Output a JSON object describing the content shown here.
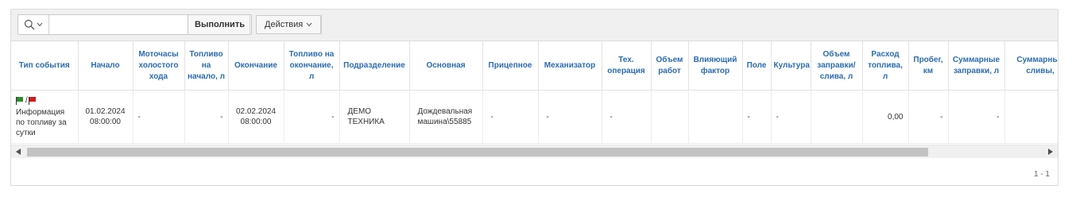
{
  "toolbar": {
    "search_placeholder": "",
    "go_label": "Выполнить",
    "actions_label": "Действия"
  },
  "table": {
    "columns": [
      "Тип события",
      "Начало",
      "Моточасы холостого хода",
      "Топливо на начало, л",
      "Окончание",
      "Топливо на окончание, л",
      "Подразделение",
      "Основная",
      "Прицепное",
      "Механизатор",
      "Тех. операция",
      "Объем работ",
      "Влияющий фактор",
      "Поле",
      "Культура",
      "Объем заправки/ слива, л",
      "Расход топлива, л",
      "Пробег, км",
      "Суммарные заправки, л",
      "Суммарные сливы,"
    ],
    "rows": [
      {
        "event_type": "Информация по топливу за сутки",
        "flag_separator": "/",
        "start": "01.02.2024 08:00:00",
        "idle_hours": "-",
        "fuel_start": "-",
        "end": "02.02.2024 08:00:00",
        "fuel_end": "-",
        "division": "ДЕМО ТЕХНИКА",
        "main": "Дождевальная машина\\55885",
        "trailer": "-",
        "operator": "-",
        "tech_operation": "-",
        "work_volume": "",
        "factor": "",
        "field": "-",
        "crop": "-",
        "refuel_volume": "",
        "fuel_consumption": "0,00",
        "mileage": "-",
        "total_refuels": "-",
        "total_drains": ""
      }
    ]
  },
  "pagination": {
    "range": "1 - 1"
  },
  "colors": {
    "header_text": "#2b6cb0",
    "flag_green": "#2e8b2e",
    "flag_red": "#d61a1a"
  }
}
